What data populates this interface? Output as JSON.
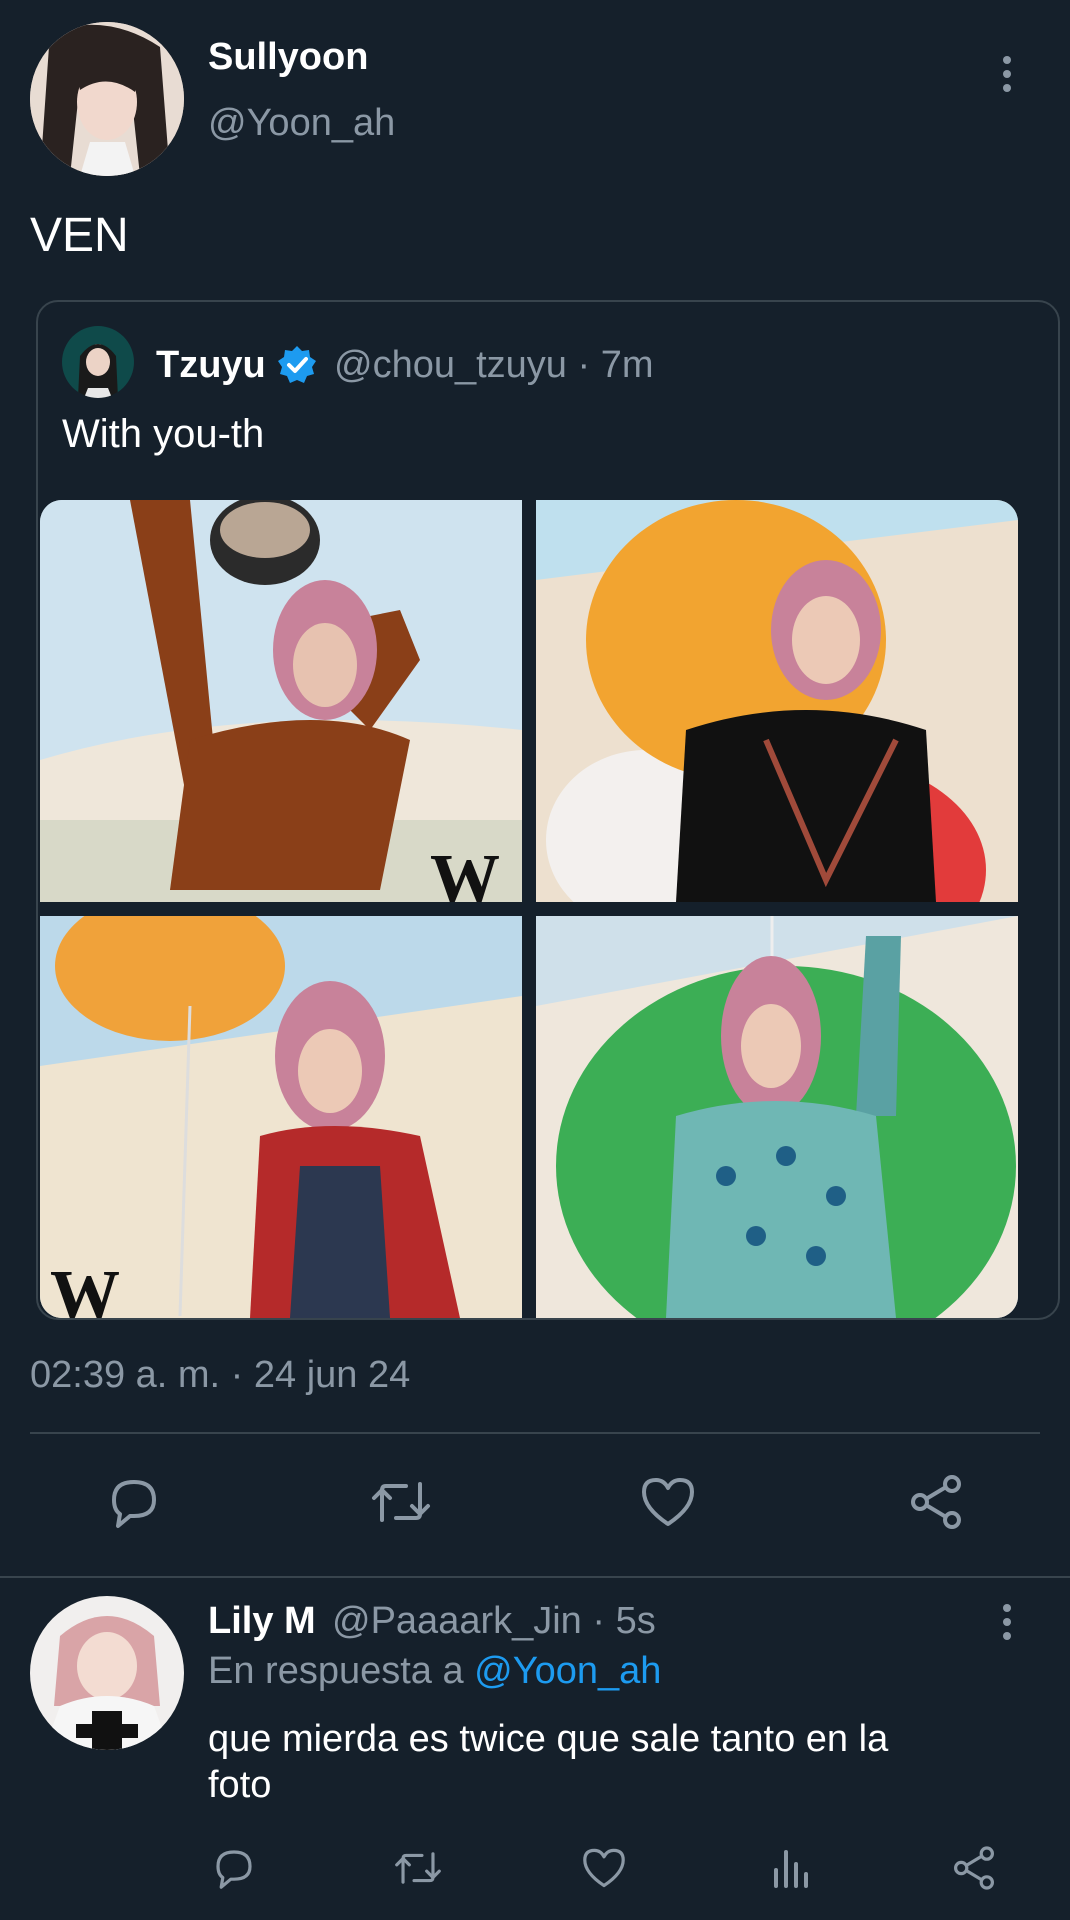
{
  "tweet": {
    "display_name": "Sullyoon",
    "handle": "@Yoon_ah",
    "text": "VEN",
    "timestamp": "02:39 a. m. · 24 jun 24"
  },
  "quoted": {
    "display_name": "Tzuyu",
    "handle_time": "@chou_tzuyu · 7m",
    "text": "With you-th",
    "photos": [
      {
        "desc": "brown sweater",
        "bg": "#cfe3ef",
        "accent": "#8a3f18"
      },
      {
        "desc": "orange balloon black cardigan",
        "bg": "#e9dccb",
        "accent": "#f2a430"
      },
      {
        "desc": "orange balloon checker sweater",
        "bg": "#efe6d6",
        "accent": "#f0a23a"
      },
      {
        "desc": "green balloon polka cardigan",
        "bg": "#dfe7ee",
        "accent": "#3cae55"
      }
    ],
    "magazine_mark": "W"
  },
  "reply": {
    "display_name": "Lily M",
    "handle_time": "@Paaaark_Jin · 5s",
    "replying_prefix": "En respuesta a ",
    "replying_to": "@Yoon_ah",
    "text_line1": "que mierda es twice que sale tanto en la",
    "text_line2": "foto"
  },
  "colors": {
    "background": "#15202b",
    "muted": "#8b98a5",
    "accent": "#1d9bf0",
    "divider": "#38444d"
  },
  "icons": {
    "actions": [
      "reply-icon",
      "retweet-icon",
      "like-icon",
      "share-icon"
    ],
    "reply_actions": [
      "reply-icon",
      "retweet-icon",
      "like-icon",
      "views-icon",
      "share-icon"
    ]
  }
}
